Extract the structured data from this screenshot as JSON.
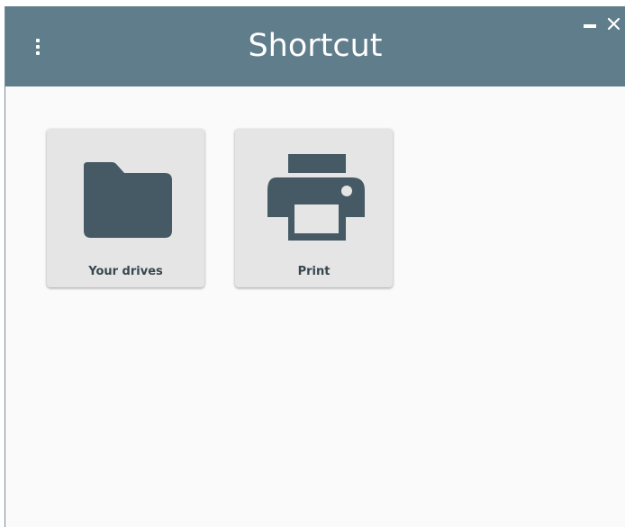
{
  "window": {
    "title": "Shortcut",
    "header_color": "#607d8b",
    "background_color": "#fafafa"
  },
  "header": {
    "menu_icon": "more-vert-icon",
    "minimize_icon": "minimize-icon",
    "close_icon": "close-icon"
  },
  "tiles": [
    {
      "label": "Your drives",
      "icon": "folder-icon"
    },
    {
      "label": "Print",
      "icon": "printer-icon"
    }
  ],
  "colors": {
    "icon": "#455a64",
    "tile": "#e5e5e5",
    "label": "#37474f"
  }
}
